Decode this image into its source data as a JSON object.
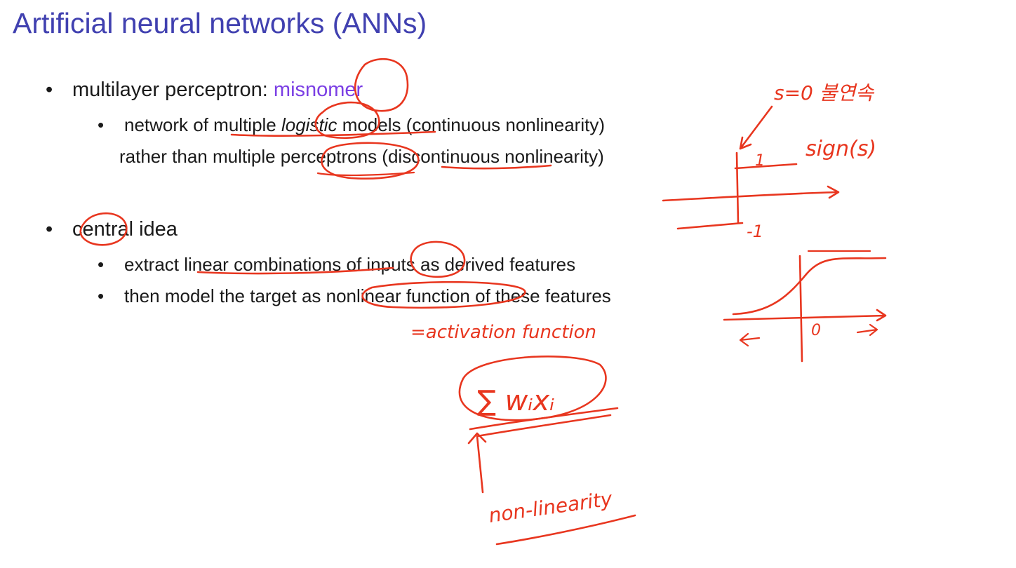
{
  "slide": {
    "title": "Artificial neural networks (ANNs)",
    "bullet_glyph": "•"
  },
  "bullets": {
    "b1": {
      "prefix": "multilayer perceptron: ",
      "accent": "misnomer"
    },
    "b1_sub": {
      "line1_a": "network of multiple ",
      "line1_italic": "logistic",
      "line1_b": " models (continuous nonlinearity)",
      "line2": "rather than multiple perceptrons (discontinuous nonlinearity)"
    },
    "b2": {
      "text": "central idea"
    },
    "b2_sub1": {
      "text": "extract linear combinations of inputs as derived features"
    },
    "b2_sub2": {
      "text": "then model the target as nonlinear function of these features"
    }
  },
  "annotations": {
    "note_step": "s=0 불연속",
    "note_sign": "sign(s)",
    "step_one": "1",
    "step_minus_one": "-1",
    "sig_zero": "0",
    "activation": "=activation function",
    "sum_formula": "∑ wᵢxᵢ",
    "nonlinearity": "non-linearity",
    "ink_color": "#e8361f"
  }
}
